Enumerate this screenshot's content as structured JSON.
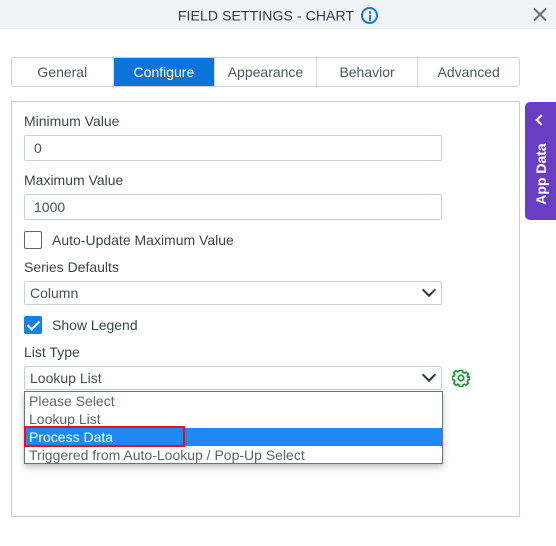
{
  "dialog": {
    "title": "FIELD SETTINGS - CHART",
    "info_icon": "info-icon",
    "close_icon": "close-icon"
  },
  "tabs": [
    {
      "label": "General",
      "active": false
    },
    {
      "label": "Configure",
      "active": true
    },
    {
      "label": "Appearance",
      "active": false
    },
    {
      "label": "Behavior",
      "active": false
    },
    {
      "label": "Advanced",
      "active": false
    }
  ],
  "form": {
    "minimum_value": {
      "label": "Minimum Value",
      "value": "0"
    },
    "maximum_value": {
      "label": "Maximum Value",
      "value": "1000"
    },
    "auto_update_max": {
      "label": "Auto-Update Maximum Value",
      "checked": false
    },
    "series_defaults": {
      "label": "Series Defaults",
      "value": "Column"
    },
    "show_legend": {
      "label": "Show Legend",
      "checked": true
    },
    "list_type": {
      "label": "List Type",
      "value": "Lookup List",
      "options": [
        "Please Select",
        "Lookup List",
        "Process Data",
        "Triggered from Auto-Lookup / Pop-Up Select"
      ],
      "highlighted_option": "Process Data",
      "settings_icon": "gear-icon"
    }
  },
  "side_panel": {
    "label": "App Data",
    "icon": "chevron-left-icon"
  },
  "colors": {
    "accent": "#0a74da",
    "app_data": "#6a3ec3",
    "gear": "#1e9a3a",
    "annotation": "#e3131e"
  }
}
